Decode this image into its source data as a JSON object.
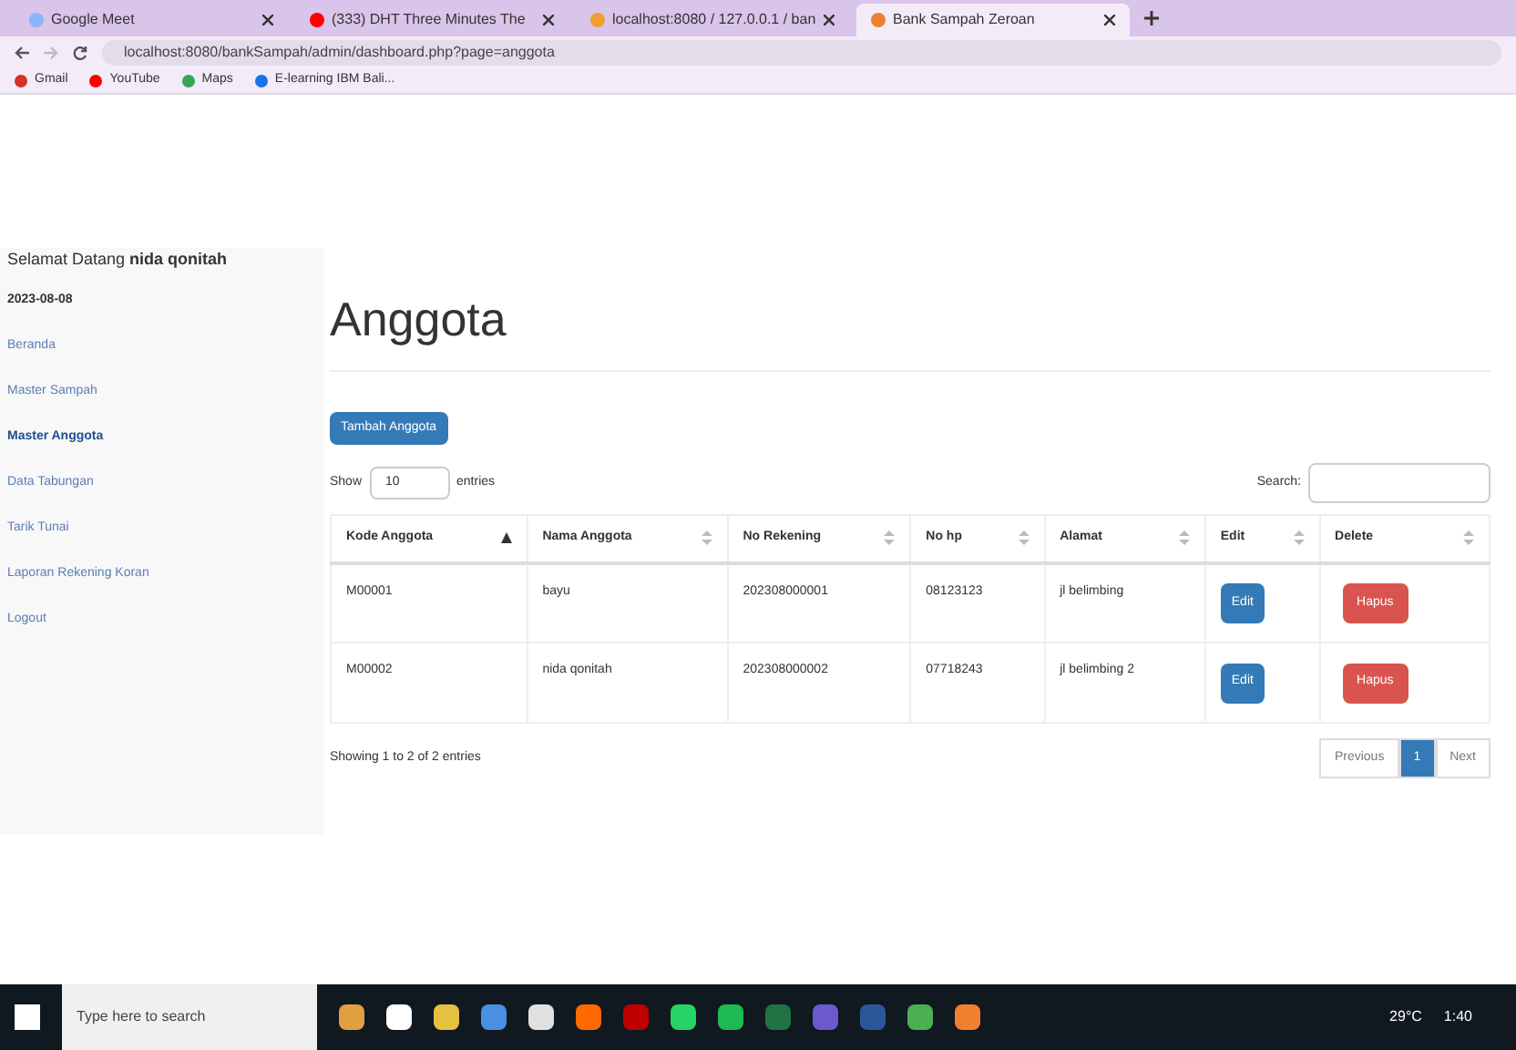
{
  "browser": {
    "tabs": [
      {
        "title": "Google Meet",
        "selected": false,
        "color": "#8ab4f8"
      },
      {
        "title": "(333) DHT Three Minutes The",
        "selected": false,
        "color": "#ff0000"
      },
      {
        "title": "localhost:8080 / 127.0.0.1 / ban",
        "selected": false,
        "color": "#f0a030"
      },
      {
        "title": "Bank Sampah Zeroan",
        "selected": true,
        "color": "#f08030"
      }
    ],
    "url": "localhost:8080/bankSampah/admin/dashboard.php?page=anggota",
    "bookmarks": [
      {
        "label": "Gmail",
        "color": "#d93025"
      },
      {
        "label": "YouTube",
        "color": "#ff0000"
      },
      {
        "label": "Maps",
        "color": "#34a853"
      },
      {
        "label": "E-learning IBM Bali...",
        "color": "#1a73e8"
      }
    ]
  },
  "sidebar": {
    "greeting": "Selamat Datang **nida qonitah**",
    "date": "2023-08-08",
    "items": [
      {
        "label": "Beranda",
        "selected": false
      },
      {
        "label": "Master Sampah",
        "selected": false
      },
      {
        "label": "Master Anggota",
        "selected": true
      },
      {
        "label": "Data Tabungan",
        "selected": false
      },
      {
        "label": "Tarik Tunai",
        "selected": false
      },
      {
        "label": "Laporan Rekening Koran",
        "selected": false
      },
      {
        "label": "Logout",
        "selected": false
      }
    ]
  },
  "page": {
    "title": "Anggota",
    "add_button": "Tambah Anggota",
    "show_label": "Show",
    "page_size": "10",
    "entries_label": "entries",
    "search_label": "Search:",
    "table": {
      "columns": [
        {
          "label": "Kode Anggota",
          "sorted": true
        },
        {
          "label": "Nama Anggota",
          "sorted": false
        },
        {
          "label": "No Rekening",
          "sorted": false
        },
        {
          "label": "No hp",
          "sorted": false
        },
        {
          "label": "Alamat",
          "sorted": false
        },
        {
          "label": "Edit",
          "sorted": false
        },
        {
          "label": "Delete",
          "sorted": false
        }
      ],
      "rows": [
        {
          "cells": [
            "M00001",
            "bayu",
            "202308000001",
            "08123123",
            "jl belimbing"
          ],
          "edit": "Edit",
          "delete": "Hapus"
        },
        {
          "cells": [
            "M00002",
            "nida qonitah",
            "202308000002",
            "07718243",
            "jl belimbing 2"
          ],
          "edit": "Edit",
          "delete": "Hapus"
        }
      ]
    },
    "info": "Showing 1 to 2 of 2 entries",
    "pagination": [
      {
        "label": "Previous",
        "selected": false
      },
      {
        "label": "1",
        "selected": true
      },
      {
        "label": "Next",
        "selected": false
      }
    ]
  },
  "taskbar": {
    "search_placeholder": "Type here to search",
    "weather": "29°C",
    "time": "1:40"
  }
}
